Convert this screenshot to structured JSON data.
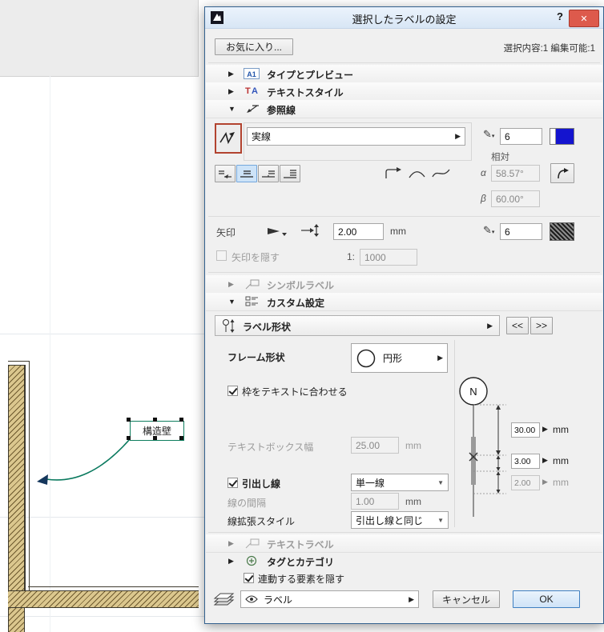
{
  "canvas": {
    "label_text": "構造壁"
  },
  "dialog": {
    "title": "選択したラベルの設定",
    "help": "?",
    "favorites": "お気に入り...",
    "selection_info": "選択内容:1 編集可能:1",
    "sections": {
      "type_preview": "タイプとプレビュー",
      "text_style": "テキストスタイル",
      "reference_line": "参照線",
      "symbol_label": "シンボルラベル",
      "custom_settings": "カスタム設定",
      "text_label": "テキストラベル",
      "tags_categories": "タグとカテゴリ"
    },
    "ref": {
      "line_type": "実線",
      "pen": "6",
      "relative": "相対",
      "alpha": "58.57°",
      "beta": "60.00°"
    },
    "arrow": {
      "label": "矢印",
      "size": "2.00",
      "unit": "mm",
      "pen": "6",
      "hide_label": "矢印を隠す",
      "scale_prefix": "1:",
      "scale_value": "1000"
    },
    "custom": {
      "label_shape": "ラベル形状",
      "collapse": "<<",
      "expand": ">>",
      "frame_shape_label": "フレーム形状",
      "frame_shape_value": "円形",
      "fit_frame_label": "枠をテキストに合わせる",
      "textbox_width_label": "テキストボックス幅",
      "textbox_width_value": "25.00",
      "unit": "mm",
      "preview_letter": "N",
      "dim_top": "30.00",
      "dim_mid": "3.00",
      "dim_bottom": "2.00",
      "leader_label": "引出し線",
      "leader_value": "単一線",
      "spacing_label": "線の間隔",
      "spacing_value": "1.00",
      "extension_label": "線拡張スタイル",
      "extension_value": "引出し線と同じ"
    },
    "hide_linked_label": "連動する要素を隠す",
    "layer_value": "ラベル",
    "cancel": "キャンセル",
    "ok": "OK"
  },
  "icons": {
    "collapsed": "▶",
    "expanded": "▼",
    "menu_arrow": "▶",
    "combo_arrow": "▼",
    "spin_arrow": "▶",
    "dropdown_small": "▾",
    "pen": "✎",
    "close": "✕",
    "alpha": "α",
    "beta": "β",
    "type_badge": "A1",
    "text_t": "T",
    "text_a": "A"
  }
}
